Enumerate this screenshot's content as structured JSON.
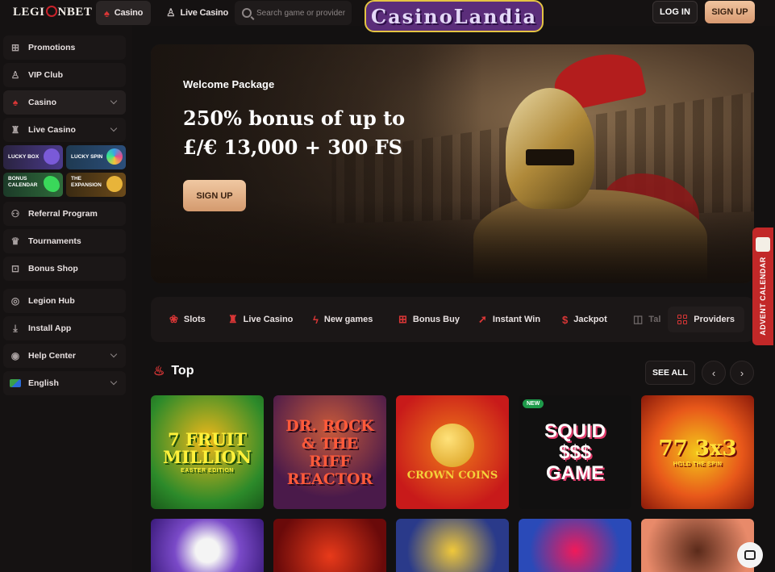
{
  "header": {
    "logo": "LEGIONBET",
    "nav": [
      {
        "label": "Casino",
        "icon": "spade-icon"
      },
      {
        "label": "Live Casino",
        "icon": "dealer-icon"
      }
    ],
    "search_placeholder": "Search game or provider",
    "watermark": "CasinoLandia",
    "login": "LOG IN",
    "signup": "SIGN UP"
  },
  "sidebar": {
    "items": [
      {
        "label": "Promotions",
        "icon": "gift-icon"
      },
      {
        "label": "VIP Club",
        "icon": "user-icon"
      },
      {
        "label": "Casino",
        "icon": "spade-icon"
      },
      {
        "label": "Live Casino",
        "icon": "dealer-icon"
      }
    ],
    "promos": [
      "LUCKY BOX",
      "LUCKY SPIN",
      "BONUS CALENDAR",
      "THE EXPANSION"
    ],
    "items2": [
      {
        "label": "Referral Program",
        "icon": "users-icon"
      },
      {
        "label": "Tournaments",
        "icon": "trophy-icon"
      },
      {
        "label": "Bonus Shop",
        "icon": "bag-icon"
      }
    ],
    "items3": [
      {
        "label": "Legion Hub",
        "icon": "hub-icon"
      },
      {
        "label": "Install App",
        "icon": "download-icon"
      },
      {
        "label": "Help Center",
        "icon": "help-icon"
      },
      {
        "label": "English",
        "icon": "flag-icon"
      }
    ]
  },
  "banner": {
    "welcome": "Welcome Package",
    "headline_1": "250% bonus of up to",
    "headline_2": "£/€ 13,000 + 300 FS",
    "button": "SIGN UP"
  },
  "categories": [
    {
      "label": "Slots",
      "icon": "cherries-icon"
    },
    {
      "label": "Live Casino",
      "icon": "dealer-icon"
    },
    {
      "label": "New games",
      "icon": "bolt-icon"
    },
    {
      "label": "Bonus Buy",
      "icon": "gift-icon"
    },
    {
      "label": "Instant Win",
      "icon": "rocket-icon"
    },
    {
      "label": "Jackpot",
      "icon": "moneybag-icon"
    },
    {
      "label": "Tal",
      "icon": "table-icon"
    }
  ],
  "providers_label": "Providers",
  "top": {
    "title": "Top",
    "see_all": "SEE ALL",
    "games": [
      {
        "title": "7 FRUIT MILLION",
        "subtitle": "EASTER EDITION"
      },
      {
        "title": "DR. ROCK & THE RIFF REACTOR",
        "subtitle": ""
      },
      {
        "title": "CROWN COINS",
        "subtitle": ""
      },
      {
        "title": "SQUID $$$ GAME",
        "subtitle": "",
        "badge": "NEW"
      },
      {
        "title": "77 3x3",
        "subtitle": "HOLD THE SPIN"
      }
    ]
  },
  "advent_label": "ADVENT CALENDAR"
}
